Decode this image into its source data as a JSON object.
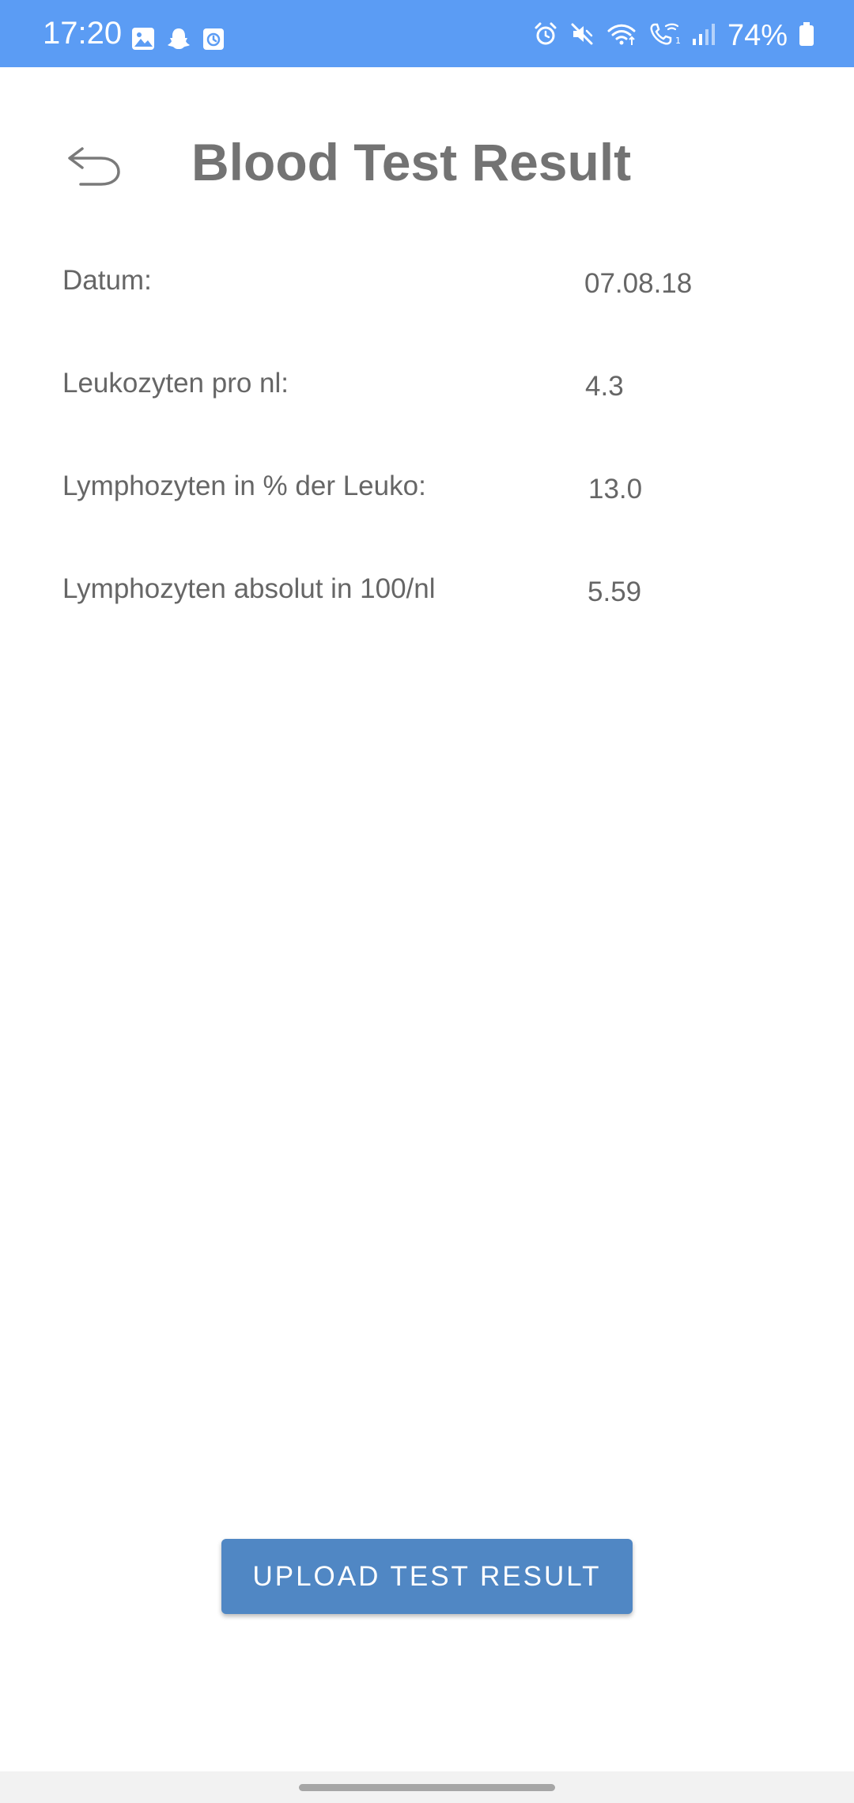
{
  "status_bar": {
    "time": "17:20",
    "battery": "74%",
    "left_icons": [
      "gallery-icon",
      "snapchat-icon",
      "calendar-icon"
    ],
    "right_icons": [
      "alarm-icon",
      "mute-icon",
      "wifi-icon",
      "wifi-call-icon",
      "signal-icon",
      "battery-icon"
    ],
    "background_color": "#5b9cf4"
  },
  "header": {
    "title": "Blood Test Result",
    "back_icon": "back-arrow-icon"
  },
  "results": [
    {
      "label": "Datum:",
      "value": "07.08.18"
    },
    {
      "label": "Leukozyten pro nl:",
      "value": "4.3"
    },
    {
      "label": "Lymphozyten in % der Leuko:",
      "value": "13.0"
    },
    {
      "label": "Lymphozyten absolut in 100/nl",
      "value": "5.59"
    }
  ],
  "actions": {
    "upload_label": "UPLOAD TEST RESULT",
    "button_color": "#5087c4"
  }
}
